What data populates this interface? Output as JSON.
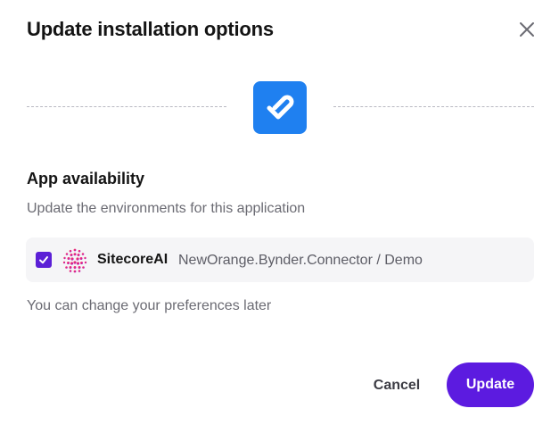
{
  "dialog": {
    "title": "Update installation options",
    "close_icon": "close-icon"
  },
  "app": {
    "logo_icon": "bynder-logo-icon",
    "logo_color": "#1f80f0"
  },
  "availability": {
    "heading": "App availability",
    "description": "Update the environments for this application",
    "environments": [
      {
        "checked": true,
        "brand_icon": "sitecore-logo-icon",
        "brand": "SitecoreAI",
        "path": "NewOrange.Bynder.Connector / Demo"
      }
    ]
  },
  "note": "You can change your preferences later",
  "actions": {
    "cancel_label": "Cancel",
    "update_label": "Update",
    "accent_color": "#5c1be0"
  }
}
